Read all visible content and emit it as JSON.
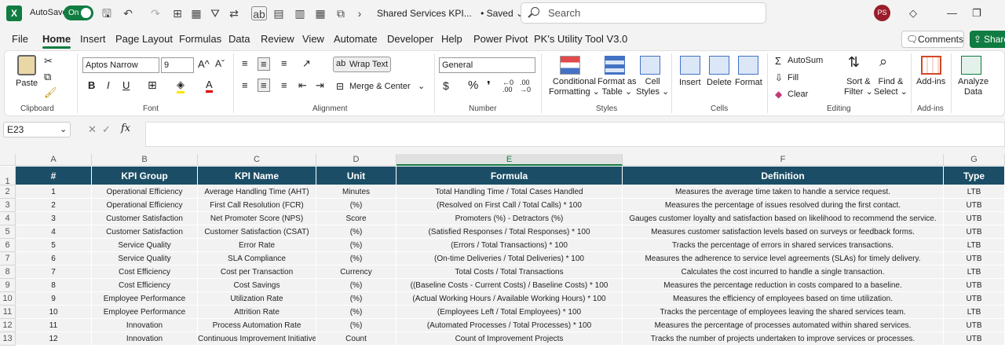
{
  "title_bar": {
    "app_logo": "X",
    "autosave_label": "AutoSave",
    "autosave_state": "On",
    "doc_title": "Shared Services KPI...",
    "saved_status": "• Saved ⌄",
    "search_placeholder": "Search",
    "avatar_initials": "PS"
  },
  "menu": {
    "items": [
      "File",
      "Home",
      "Insert",
      "Page Layout",
      "Formulas",
      "Data",
      "Review",
      "View",
      "Automate",
      "Developer",
      "Help",
      "Power Pivot",
      "PK's Utility Tool V3.0"
    ],
    "active": "Home",
    "comments_label": "Comments",
    "share_label": "Share"
  },
  "ribbon": {
    "paste_label": "Paste",
    "font_name": "Aptos Narrow",
    "font_size": "9",
    "wrap_text_label": "Wrap Text",
    "merge_center_label": "Merge & Center",
    "number_format": "General",
    "conditional_formatting": [
      "Conditional",
      "Formatting ⌄"
    ],
    "format_as_table": [
      "Format as",
      "Table ⌄"
    ],
    "cell_styles": [
      "Cell",
      "Styles ⌄"
    ],
    "insert_label": "Insert",
    "delete_label": "Delete",
    "format_label": "Format",
    "autosum_label": "AutoSum",
    "fill_label": "Fill",
    "clear_label": "Clear",
    "sort_filter": [
      "Sort &",
      "Filter ⌄"
    ],
    "find_select": [
      "Find &",
      "Select ⌄"
    ],
    "add_ins_label": "Add-ins",
    "analyze_data": [
      "Analyze",
      "Data"
    ],
    "groups": {
      "clipboard": "Clipboard",
      "font": "Font",
      "alignment": "Alignment",
      "number": "Number",
      "styles": "Styles",
      "cells": "Cells",
      "editing": "Editing",
      "add_ins": "Add-ins"
    }
  },
  "formula_bar": {
    "name_box": "E23",
    "fx": "fx",
    "content": ""
  },
  "sheet": {
    "columns": [
      "A",
      "B",
      "C",
      "D",
      "E",
      "F",
      "G"
    ],
    "selected_column": "E",
    "row_numbers": [
      "1",
      "2",
      "3",
      "4",
      "5",
      "6",
      "7",
      "8",
      "9",
      "10",
      "11",
      "12",
      "13"
    ],
    "header": [
      "#",
      "KPI Group",
      "KPI Name",
      "Unit",
      "Formula",
      "Definition",
      "Type"
    ],
    "rows": [
      [
        "1",
        "Operational Efficiency",
        "Average Handling Time (AHT)",
        "Minutes",
        "Total Handling Time / Total Cases Handled",
        "Measures the average time taken to handle a service request.",
        "LTB"
      ],
      [
        "2",
        "Operational Efficiency",
        "First Call Resolution (FCR)",
        "(%)",
        "(Resolved on First Call / Total Calls) * 100",
        "Measures the percentage of issues resolved during the first contact.",
        "UTB"
      ],
      [
        "3",
        "Customer Satisfaction",
        "Net Promoter Score (NPS)",
        "Score",
        "Promoters (%) - Detractors (%)",
        "Gauges customer loyalty and satisfaction based on likelihood to recommend the service.",
        "UTB"
      ],
      [
        "4",
        "Customer Satisfaction",
        "Customer Satisfaction (CSAT)",
        "(%)",
        "(Satisfied Responses / Total Responses) * 100",
        "Measures customer satisfaction levels based on surveys or feedback forms.",
        "UTB"
      ],
      [
        "5",
        "Service Quality",
        "Error Rate",
        "(%)",
        "(Errors / Total Transactions) * 100",
        "Tracks the percentage of errors in shared services transactions.",
        "LTB"
      ],
      [
        "6",
        "Service Quality",
        "SLA Compliance",
        "(%)",
        "(On-time Deliveries / Total Deliveries) * 100",
        "Measures the adherence to service level agreements (SLAs) for timely delivery.",
        "UTB"
      ],
      [
        "7",
        "Cost Efficiency",
        "Cost per Transaction",
        "Currency",
        "Total Costs / Total Transactions",
        "Calculates the cost incurred to handle a single transaction.",
        "LTB"
      ],
      [
        "8",
        "Cost Efficiency",
        "Cost Savings",
        "(%)",
        "((Baseline Costs - Current Costs) / Baseline Costs) * 100",
        "Measures the percentage reduction in costs compared to a baseline.",
        "UTB"
      ],
      [
        "9",
        "Employee Performance",
        "Utilization Rate",
        "(%)",
        "(Actual Working Hours / Available Working Hours) * 100",
        "Measures the efficiency of employees based on time utilization.",
        "UTB"
      ],
      [
        "10",
        "Employee Performance",
        "Attrition Rate",
        "(%)",
        "(Employees Left / Total Employees) * 100",
        "Tracks the percentage of employees leaving the shared services team.",
        "LTB"
      ],
      [
        "11",
        "Innovation",
        "Process Automation Rate",
        "(%)",
        "(Automated Processes / Total Processes) * 100",
        "Measures the percentage of processes automated within shared services.",
        "UTB"
      ],
      [
        "12",
        "Innovation",
        "Continuous Improvement Initiatives",
        "Count",
        "Count of Improvement Projects",
        "Tracks the number of projects undertaken to improve services or processes.",
        "UTB"
      ]
    ]
  },
  "colors": {
    "accent": "#107c41",
    "header_fill": "#1b4e66",
    "cell_fill": "#f2f2f2"
  }
}
